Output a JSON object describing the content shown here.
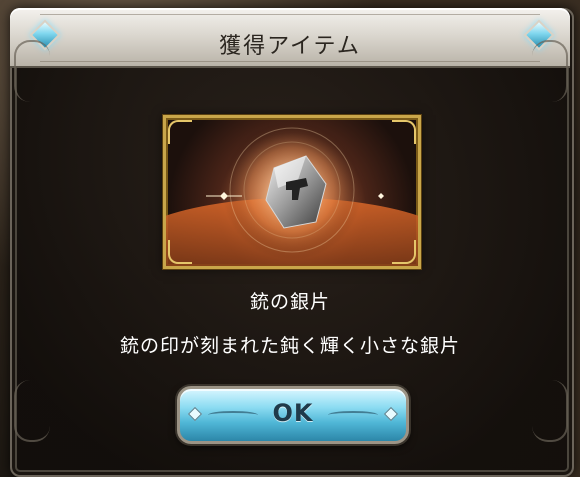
{
  "dialog": {
    "title": "獲得アイテム",
    "item_name": "銃の銀片",
    "item_description": "銃の印が刻まれた鈍く輝く小さな銀片",
    "item_icon": "silver-fragment-gun-emblem",
    "ok_label": "OK"
  },
  "colors": {
    "title_bar": "#dcd8d0",
    "frame_gold": "#c9a64a",
    "button_cyan": "#8ddcf2",
    "gem_blue": "#7fd6ee"
  }
}
